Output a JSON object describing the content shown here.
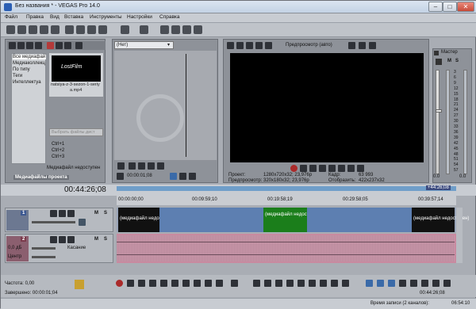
{
  "window": {
    "title": "Без названия * - VEGAS Pro 14.0"
  },
  "menu": {
    "items": [
      "Файл",
      "Правка",
      "Вид",
      "Вставка",
      "Инструменты",
      "Настройки",
      "Справка"
    ]
  },
  "media": {
    "categories": [
      "Все медиафай",
      "Медиаколлекц",
      "По типу",
      "Теги",
      "Интеллектуа"
    ],
    "thumb_caption": "natsiya-z-3-sezon-1-seriya.mp4",
    "thumb_caption_line1": "natsiya-z-3-sezon-1-seriy",
    "thumb_caption_line2": "a.mp4",
    "thumb_logo": "LostFilm",
    "select_btn": "Выбрать файлы дист",
    "shortcuts": [
      "Ctrl+1",
      "Ctrl+2",
      "Ctrl+3"
    ],
    "status": "Медиафайл недоступен",
    "tab": "Медиафайлы проекта"
  },
  "trimmer": {
    "dropdown": "(Нет)",
    "time": "00:00:01;08"
  },
  "preview": {
    "mode": "Предпросмотр (авто)",
    "project_label": "Проект:",
    "project_val": "1280x720x32; 23,976p",
    "preview_label": "Предпросмотр:",
    "preview_val": "320x180x32; 23,976p",
    "frame_label": "Кадр:",
    "frame_val": "63 993",
    "display_label": "Отобразить:",
    "display_val": "422x237x32"
  },
  "master": {
    "title": "Мастер",
    "m": "M",
    "s": "S",
    "levels": [
      "3",
      "6",
      "9",
      "12",
      "15",
      "18",
      "21",
      "24",
      "27",
      "30",
      "33",
      "36",
      "39",
      "42",
      "45",
      "48",
      "51",
      "54",
      "57"
    ],
    "bottom_left": "0.0",
    "bottom_right": "0.0"
  },
  "timeline": {
    "time": "00:44:26;08",
    "marker": "+44:26;08",
    "ruler": [
      "00:00:00;00",
      "00:09:59;10",
      "00:19:58;19",
      "00:29:58;05",
      "00:39:57;14"
    ],
    "track1_num": "1",
    "track2_num": "2",
    "track_m": "M",
    "track_s": "S",
    "clip_label": "(медиафайл недоступен)",
    "audio_db": "0,0 дБ",
    "audio_mode": "Касание",
    "audio_pan": "Центр"
  },
  "bottom": {
    "rate": "Частота: 0,00",
    "done": "Завершено: 00:00:01;04",
    "time": "00:44:26;08",
    "record_time": "Время записи (2 каналов):",
    "record_val": "06:54:10"
  }
}
